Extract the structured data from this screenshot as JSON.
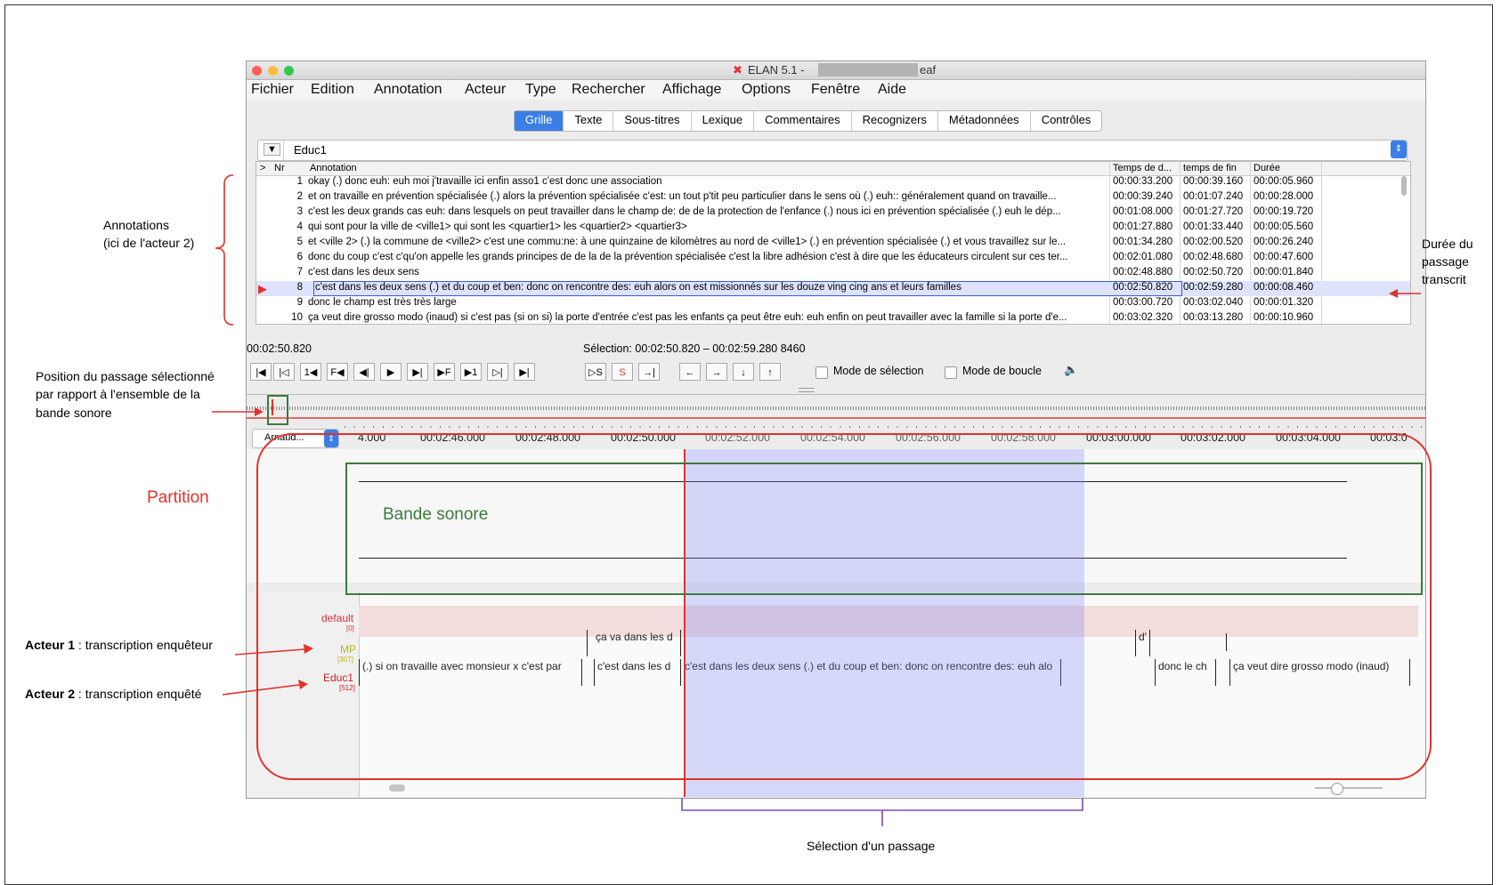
{
  "window": {
    "app_title": "ELAN 5.1 -",
    "file_suffix": "eaf"
  },
  "menu": [
    "Fichier",
    "Edition",
    "Annotation",
    "Acteur",
    "Type",
    "Rechercher",
    "Affichage",
    "Options",
    "Fenêtre",
    "Aide"
  ],
  "tabs": [
    "Grille",
    "Texte",
    "Sous-titres",
    "Lexique",
    "Commentaires",
    "Recognizers",
    "Métadonnées",
    "Contrôles"
  ],
  "tier_selector": "Educ1",
  "grid": {
    "headers": {
      "expand": ">",
      "nr": "Nr",
      "annotation": "Annotation",
      "begin": "Temps de d...",
      "end": "temps de fin",
      "duration": "Durée"
    },
    "rows": [
      {
        "nr": "1",
        "text": "okay (.) donc euh: euh moi j'travaille ici enfin asso1 c'est donc une association",
        "begin": "00:00:33.200",
        "end": "00:00:39.160",
        "dur": "00:00:05.960"
      },
      {
        "nr": "2",
        "text": "et on travaille en prévention spécialisée (.) alors la prévention spécialisée c'est: un tout p'tit peu particulier dans le sens où (.) euh:: généralement quand on travaille...",
        "begin": "00:00:39.240",
        "end": "00:01:07.240",
        "dur": "00:00:28.000"
      },
      {
        "nr": "3",
        "text": "c'est les deux grands cas euh: dans lesquels on peut travailler dans le champ de: de de la protection de l'enfance (.) nous ici en prévention spécialisée (.) euh le dép...",
        "begin": "00:01:08.000",
        "end": "00:01:27.720",
        "dur": "00:00:19.720"
      },
      {
        "nr": "4",
        "text": "qui sont pour la ville de <ville1> qui sont les <quartier1> les <quartier2> <quartier3>",
        "begin": "00:01:27.880",
        "end": "00:01:33.440",
        "dur": "00:00:05.560"
      },
      {
        "nr": "5",
        "text": "et <ville 2> (.) la commune de <ville2> c'est une commu:ne: à une quinzaine de kilomètres au nord de <ville1> (.) en prévention spécialisée (.) et vous travaillez sur le...",
        "begin": "00:01:34.280",
        "end": "00:02:00.520",
        "dur": "00:00:26.240"
      },
      {
        "nr": "6",
        "text": "donc du coup c'est c'qu'on appelle les grands principes de de la de la prévention spécialisée c'est la libre adhésion c'est à dire que les éducateurs circulent sur ces ter...",
        "begin": "00:02:01.080",
        "end": "00:02:48.680",
        "dur": "00:00:47.600"
      },
      {
        "nr": "7",
        "text": "c'est dans les deux sens",
        "begin": "00:02:48.880",
        "end": "00:02:50.720",
        "dur": "00:00:01.840"
      },
      {
        "nr": "8",
        "text": "c'est dans les deux sens (.) et du coup et ben: donc on rencontre des: euh alors on est missionnés sur les douze ving cing ans et leurs familles",
        "begin": "00:02:50.820",
        "end": "00:02:59.280",
        "dur": "00:00:08.460"
      },
      {
        "nr": "9",
        "text": "donc le champ est très très large",
        "begin": "00:03:00.720",
        "end": "00:03:02.040",
        "dur": "00:00:01.320"
      },
      {
        "nr": "10",
        "text": "ça veut dire grosso modo (inaud) si c'est pas (si on si) la porte d'entrée c'est pas les enfants ça peut être euh: euh enfin on peut travailler avec la famille si la porte d'e...",
        "begin": "00:03:02.320",
        "end": "00:03:13.280",
        "dur": "00:00:10.960"
      }
    ],
    "selected_row": 8
  },
  "media": {
    "current_time": "00:02:50.820",
    "selection": "Sélection: 00:02:50.820 – 00:02:59.280  8460",
    "selection_mode": "Mode de sélection",
    "loop_mode": "Mode de boucle",
    "transport": [
      "|◀",
      "|◁",
      "1◀",
      "F◀",
      "◀|",
      "▶",
      "▶|",
      "▶F",
      "▶1",
      "▷|",
      "▶|"
    ],
    "sel_buttons": [
      "▷S",
      "S",
      "→|"
    ],
    "nav_buttons": [
      "←",
      "→",
      "↓",
      "↑"
    ]
  },
  "timeline": {
    "tier_dropdown": "Arnaud...",
    "ticks": [
      "4.000",
      "00:02:46.000",
      "00:02:48.000",
      "00:02:50.000",
      "00:02:52.000",
      "00:02:54.000",
      "00:02:56.000",
      "00:02:58.000",
      "00:03:00.000",
      "00:03:02.000",
      "00:03:04.000",
      "00:03:0"
    ]
  },
  "tiers": {
    "default": {
      "name": "default",
      "count": "[0]"
    },
    "mp": {
      "name": "MP",
      "count": "[307]",
      "annotations": [
        "ça va dans les d",
        "d'"
      ]
    },
    "educ1": {
      "name": "Educ1",
      "count": "[512]",
      "annotations": [
        "(.) si on travaille avec monsieur x c'est par",
        "c'est dans les d",
        "c'est dans les deux sens (.) et du coup et ben: donc on rencontre des: euh alo",
        "donc le ch",
        "ça veut dire grosso modo (inaud)"
      ]
    }
  },
  "callouts": {
    "annotations": [
      "Annotations",
      "(ici de l'acteur 2)"
    ],
    "duration": [
      "Durée du",
      "passage",
      "transcrit"
    ],
    "position": [
      "Position du passage sélectionné",
      "par rapport à l'ensemble de la",
      "bande sonore"
    ],
    "partition": "Partition",
    "bande_sonore": "Bande sonore",
    "actor1_bold": "Acteur 1",
    "actor1_rest": " : transcription enquêteur",
    "actor2_bold": "Acteur 2",
    "actor2_rest": " : transcription enquêté",
    "selection_passage": "Sélection d'un passage"
  },
  "colors": {
    "accent": "#3b7fe6",
    "callout_red": "#e0332b",
    "green": "#3b7a3b",
    "selection": "#d7dafb",
    "purple": "#7b4bb8"
  }
}
